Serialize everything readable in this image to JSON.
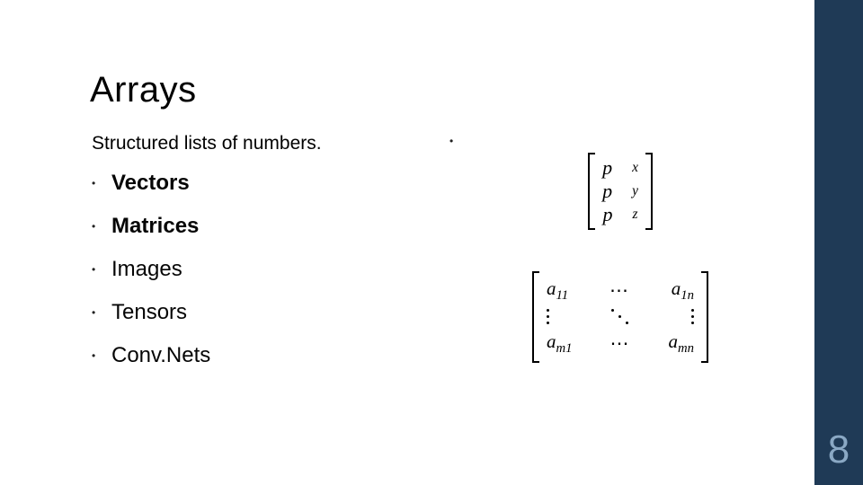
{
  "title": "Arrays",
  "subtitle": "Structured lists of numbers.",
  "bullets": [
    {
      "text": "Vectors",
      "bold": true
    },
    {
      "text": "Matrices",
      "bold": true
    },
    {
      "text": "Images",
      "bold": false
    },
    {
      "text": "Tensors",
      "bold": false
    },
    {
      "text": "Conv.Nets",
      "bold": false
    }
  ],
  "vector": {
    "rows": [
      "p_x",
      "p_y",
      "p_z"
    ]
  },
  "matrix": {
    "tl": "a_11",
    "tr": "a_1n",
    "bl": "a_m1",
    "br": "a_mn"
  },
  "page_number": "8",
  "accent_bar_color": "#1f3a56"
}
